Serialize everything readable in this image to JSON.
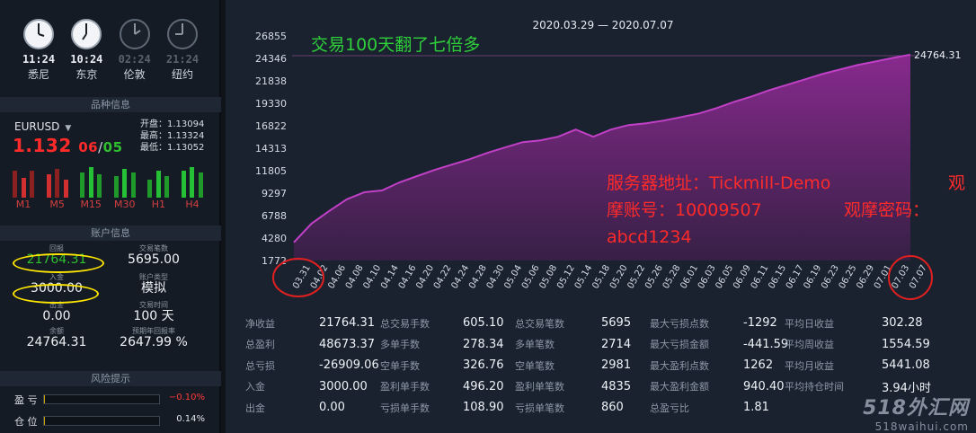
{
  "clocks": [
    {
      "time": "11:24",
      "name": "悉尼",
      "active": true
    },
    {
      "time": "10:24",
      "name": "东京",
      "active": true
    },
    {
      "time": "02:24",
      "name": "伦敦",
      "active": false
    },
    {
      "time": "21:24",
      "name": "纽约",
      "active": false
    }
  ],
  "sections": {
    "symbol_info": "品种信息",
    "account_info": "账户信息",
    "risk": "风险提示"
  },
  "symbol": {
    "name": "EURUSD",
    "price": "1.132",
    "date_day": "06",
    "date_sep": "/",
    "date_month": "05",
    "open": "开盘：1.13094",
    "high": "最高：1.13324",
    "low": "最低：1.13052"
  },
  "timeframes": [
    "M1",
    "M5",
    "M15",
    "M30",
    "H1",
    "H4"
  ],
  "account": {
    "balance_label": "回报",
    "balance": "21764.31",
    "trades_label": "交易笔数",
    "trades": "5695.00",
    "deposit_label": "入金",
    "deposit": "3000.00",
    "type_label": "账户类型",
    "type": "模拟",
    "withdraw_label": "出金",
    "withdraw": "0.00",
    "days_label": "交易时间",
    "days": "100 天",
    "equity_label": "余额",
    "equity": "24764.31",
    "annual_label": "预期年回报率",
    "annual": "2647.99 %"
  },
  "risk": [
    {
      "label": "盈 亏",
      "value": "−0.10%",
      "color": "#ff3b3b"
    },
    {
      "label": "仓 位",
      "value": "0.14%",
      "color": "#dfe4ea"
    }
  ],
  "chart_data": {
    "type": "area",
    "title": "2020.03.29 — 2020.07.07",
    "y_ticks": [
      1772,
      4280,
      6788,
      9297,
      11805,
      14313,
      16822,
      19330,
      21838,
      24346,
      26855
    ],
    "ylim": [
      1772,
      26855
    ],
    "x": [
      "03.31",
      "04.02",
      "04.06",
      "04.08",
      "04.10",
      "04.14",
      "04.16",
      "04.20",
      "04.22",
      "04.24",
      "04.28",
      "04.30",
      "05.04",
      "05.06",
      "05.08",
      "05.12",
      "05.14",
      "05.18",
      "05.20",
      "05.22",
      "05.26",
      "05.28",
      "06.01",
      "06.03",
      "06.05",
      "06.09",
      "06.11",
      "06.15",
      "06.17",
      "06.19",
      "06.23",
      "06.25",
      "06.29",
      "07.01",
      "07.03",
      "07.07"
    ],
    "values": [
      3800,
      5900,
      7300,
      8600,
      9400,
      9600,
      10500,
      11200,
      11900,
      12500,
      13100,
      13800,
      14400,
      15000,
      15200,
      15600,
      16400,
      15600,
      16400,
      16900,
      17100,
      17400,
      17800,
      18200,
      18800,
      19500,
      20100,
      20800,
      21400,
      22000,
      22600,
      23100,
      23600,
      24000,
      24400,
      24764
    ],
    "last_label": "24764.31",
    "series_color": "#b03ab5",
    "overlay_title": "交易100天翻了七倍多",
    "overlay_server": "服务器地址：Tickmill-Demo",
    "overlay_right1": "观",
    "overlay_account": "摩账号：10009507",
    "overlay_password": "观摩密码：",
    "overlay_pw_value": "abcd1234"
  },
  "stats": [
    [
      {
        "k": "净收益",
        "v": "21764.31"
      },
      {
        "k": "总盈利",
        "v": "48673.37"
      },
      {
        "k": "总亏损",
        "v": "-26909.06"
      },
      {
        "k": "入金",
        "v": "3000.00"
      },
      {
        "k": "出金",
        "v": "0.00"
      }
    ],
    [
      {
        "k": "总交易手数",
        "v": "605.10"
      },
      {
        "k": "多单手数",
        "v": "278.34"
      },
      {
        "k": "空单手数",
        "v": "326.76"
      },
      {
        "k": "盈利单手数",
        "v": "496.20"
      },
      {
        "k": "亏损单手数",
        "v": "108.90"
      }
    ],
    [
      {
        "k": "总交易笔数",
        "v": "5695"
      },
      {
        "k": "多单笔数",
        "v": "2714"
      },
      {
        "k": "空单笔数",
        "v": "2981"
      },
      {
        "k": "盈利单笔数",
        "v": "4835"
      },
      {
        "k": "亏损单笔数",
        "v": "860"
      }
    ],
    [
      {
        "k": "最大亏损点数",
        "v": "-1292"
      },
      {
        "k": "最大亏损金额",
        "v": "-441.59"
      },
      {
        "k": "最大盈利点数",
        "v": "1262"
      },
      {
        "k": "最大盈利金额",
        "v": "940.40"
      },
      {
        "k": "总盈亏比",
        "v": "1.81"
      }
    ],
    [
      {
        "k": "平均日收益",
        "v": "302.28"
      },
      {
        "k": "平均周收益",
        "v": "1554.59"
      },
      {
        "k": "平均月收益",
        "v": "5441.08"
      },
      {
        "k": "平均持仓时间",
        "v": "3.94小时"
      }
    ]
  ],
  "watermark": {
    "big": "518外汇网",
    "small": "518waihui.com"
  }
}
